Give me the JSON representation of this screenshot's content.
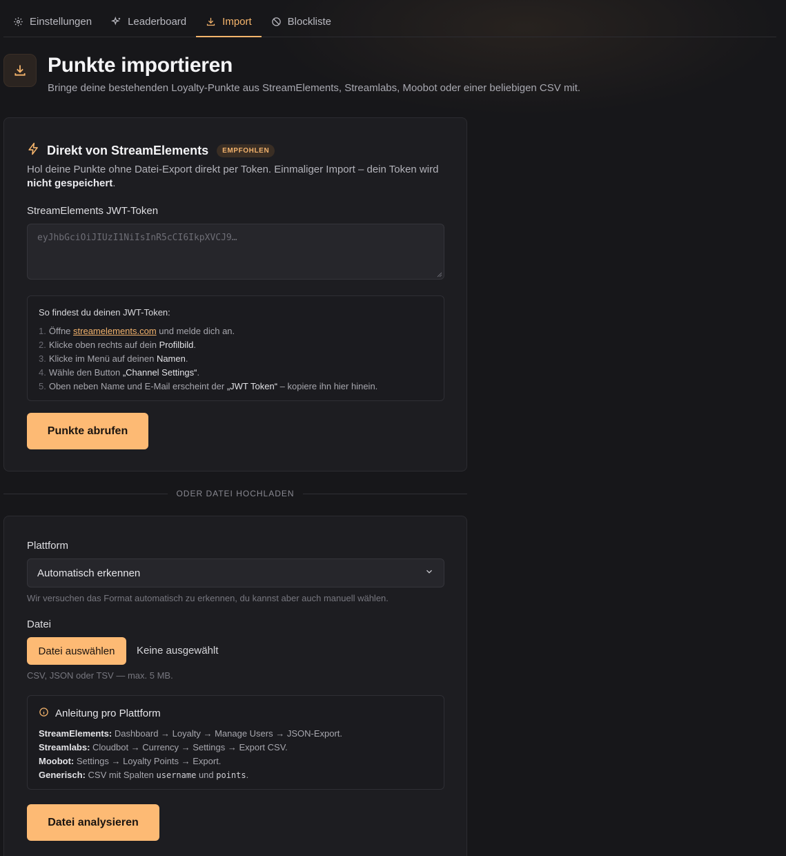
{
  "tabs": [
    {
      "label": "Einstellungen",
      "icon": "gear-icon"
    },
    {
      "label": "Leaderboard",
      "icon": "sparkles-icon"
    },
    {
      "label": "Import",
      "icon": "download-icon",
      "active": true
    },
    {
      "label": "Blockliste",
      "icon": "ban-icon"
    }
  ],
  "header": {
    "icon": "download-icon",
    "title": "Punkte importieren",
    "subtitle": "Bringe deine bestehenden Loyalty-Punkte aus StreamElements, Streamlabs, Moobot oder einer beliebigen CSV mit."
  },
  "streamelements": {
    "icon": "lightning-icon",
    "title": "Direkt von StreamElements",
    "badge": "EMPFOHLEN",
    "desc_prefix": "Hol deine Punkte ohne Datei-Export direkt per Token. Einmaliger Import – dein Token wird ",
    "desc_bold": "nicht gespeichert",
    "desc_suffix": ".",
    "token_label": "StreamElements JWT-Token",
    "token_placeholder": "eyJhbGciOiJIUzI1NiIsInR5cCI6IkpXVCJ9…",
    "help_title": "So findest du deinen JWT-Token:",
    "steps": [
      {
        "n": "1.",
        "a": "Öffne ",
        "link": "streamelements.com",
        "b": " und melde dich an."
      },
      {
        "n": "2.",
        "a": "Klicke oben rechts auf dein ",
        "w": "Profilbild",
        "b": "."
      },
      {
        "n": "3.",
        "a": "Klicke im Menü auf deinen ",
        "w": "Namen",
        "b": "."
      },
      {
        "n": "4.",
        "a": "Wähle den Button ",
        "w": "„Channel Settings“",
        "b": "."
      },
      {
        "n": "5.",
        "a": "Oben neben Name und E-Mail erscheint der ",
        "w": "„JWT Token“",
        "b": " – kopiere ihn hier hinein."
      }
    ],
    "button": "Punkte abrufen"
  },
  "divider": "ODER DATEI HOCHLADEN",
  "upload": {
    "platform_label": "Plattform",
    "platform_value": "Automatisch erkennen",
    "platform_hint": "Wir versuchen das Format automatisch zu erkennen, du kannst aber auch manuell wählen.",
    "file_label": "Datei",
    "file_button": "Datei auswählen",
    "file_status": "Keine ausgewählt",
    "file_hint": "CSV, JSON oder TSV — max. 5 MB.",
    "guide_title": "Anleitung pro Plattform",
    "guide": [
      {
        "name": "StreamElements:",
        "text": " Dashboard → Loyalty → Manage Users → JSON-Export."
      },
      {
        "name": "Streamlabs:",
        "text": " Cloudbot → Currency → Settings → Export CSV."
      },
      {
        "name": "Moobot:",
        "text": " Settings → Loyalty Points → Export."
      }
    ],
    "generic_name": "Generisch:",
    "generic_a": " CSV mit Spalten ",
    "generic_code1": "username",
    "generic_b": " und ",
    "generic_code2": "points",
    "generic_c": ".",
    "button": "Datei analysieren"
  },
  "colors": {
    "accent": "#fdba74",
    "bg": "#17171a",
    "card": "#1d1d21"
  }
}
